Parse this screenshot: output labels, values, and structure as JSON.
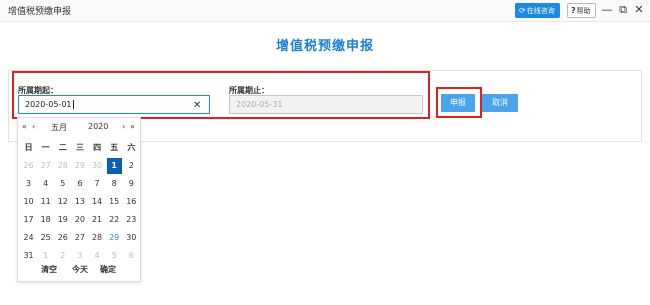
{
  "window": {
    "title": "增值税预缴申报",
    "online_label": "在线咨询",
    "help_label": "帮助",
    "minimize_glyph": "—",
    "restore_glyph": "⧉",
    "close_glyph": "✕"
  },
  "page": {
    "title": "增值税预缴申报"
  },
  "form": {
    "start_label": "所属期起：",
    "start_value": "2020-05-01",
    "end_label": "所属期止：",
    "end_value": "2020-05-31",
    "submit_label": "申报",
    "cancel_label": "取消"
  },
  "calendar": {
    "prev_year": "«",
    "prev_month": "‹",
    "next_month": "›",
    "next_year": "»",
    "month": "五月",
    "year": "2020",
    "weekdays": [
      "日",
      "一",
      "二",
      "三",
      "四",
      "五",
      "六"
    ],
    "weeks": [
      [
        "26",
        "27",
        "28",
        "29",
        "30",
        "1",
        "2"
      ],
      [
        "3",
        "4",
        "5",
        "6",
        "7",
        "8",
        "9"
      ],
      [
        "10",
        "11",
        "12",
        "13",
        "14",
        "15",
        "16"
      ],
      [
        "17",
        "18",
        "19",
        "20",
        "21",
        "22",
        "23"
      ],
      [
        "24",
        "25",
        "26",
        "27",
        "28",
        "29",
        "30"
      ],
      [
        "31",
        "1",
        "2",
        "3",
        "4",
        "5",
        "6"
      ]
    ],
    "selected_day": "1",
    "today_day": "29",
    "footer": {
      "clear": "清空",
      "today": "今天",
      "confirm": "确定"
    },
    "colors": {
      "selected": "#0a5fb4",
      "today": "#1e88e5"
    }
  },
  "colors": {
    "accent": "#1e88e5",
    "button": "#4aa3ec",
    "highlight_border": "#e02020",
    "title": "#1e7fd6"
  }
}
